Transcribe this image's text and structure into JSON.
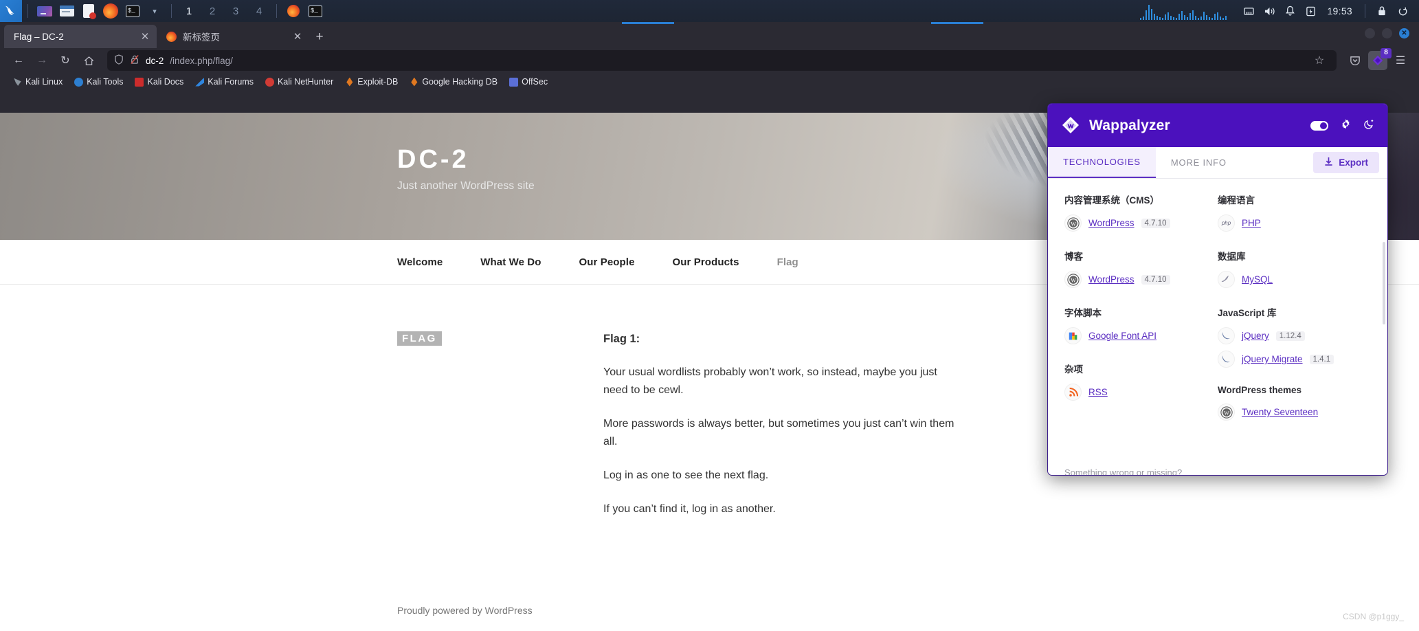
{
  "taskbar": {
    "menu_icon": "kali-dragon-icon",
    "launchers": [
      {
        "name": "app-grid-icon",
        "label": ""
      },
      {
        "name": "file-manager-icon",
        "label": ""
      },
      {
        "name": "text-editor-icon",
        "label": ""
      },
      {
        "name": "firefox-icon",
        "label": ""
      },
      {
        "name": "terminal-icon",
        "label": ""
      },
      {
        "name": "chevron-down-icon",
        "label": ""
      }
    ],
    "workspaces": [
      "1",
      "2",
      "3",
      "4"
    ],
    "active_workspace": "1",
    "running": [
      {
        "name": "firefox-window-icon"
      },
      {
        "name": "terminal-window-icon"
      }
    ],
    "tray": [
      {
        "name": "network-graph-icon"
      },
      {
        "name": "ethernet-icon"
      },
      {
        "name": "volume-icon"
      },
      {
        "name": "notification-bell-icon"
      },
      {
        "name": "battery-icon"
      }
    ],
    "clock": "19:53",
    "session": [
      {
        "name": "lock-icon"
      },
      {
        "name": "power-icon"
      }
    ]
  },
  "browser": {
    "tabs": [
      {
        "title": "Flag – DC-2",
        "active": true,
        "favicon": "none",
        "close": "✕"
      },
      {
        "title": "新标签页",
        "active": false,
        "favicon": "firefox-icon",
        "close": "✕"
      }
    ],
    "new_tab_label": "+",
    "window_controls": [
      "minimize",
      "maximize",
      "close"
    ],
    "nav": {
      "back": "←",
      "forward": "→",
      "reload": "↻",
      "home": "⌂"
    },
    "url": {
      "shield_icon": "shield-icon",
      "lock_icon": "lock-crossed-icon",
      "host": "dc-2",
      "path": "/index.php/flag/",
      "bookmark_star": "☆",
      "pocket_icon": "pocket-icon",
      "extension_icon": "wappalyzer-extension-icon",
      "extension_count": "8",
      "menu_icon": "☰"
    },
    "bookmarks": [
      {
        "label": "Kali Linux",
        "color": "#8a939c"
      },
      {
        "label": "Kali Tools",
        "color": "#2d7fd1"
      },
      {
        "label": "Kali Docs",
        "color": "#cc2c2c"
      },
      {
        "label": "Kali Forums",
        "color": "#2f86e0"
      },
      {
        "label": "Kali NetHunter",
        "color": "#d13b35"
      },
      {
        "label": "Exploit-DB",
        "color": "#e07820"
      },
      {
        "label": "Google Hacking DB",
        "color": "#e07820"
      },
      {
        "label": "OffSec",
        "color": "#5b6fd6"
      }
    ]
  },
  "page": {
    "site_title": "DC-2",
    "tagline": "Just another WordPress site",
    "nav_items": [
      {
        "label": "Welcome",
        "current": false
      },
      {
        "label": "What We Do",
        "current": false
      },
      {
        "label": "Our People",
        "current": false
      },
      {
        "label": "Our Products",
        "current": false
      },
      {
        "label": "Flag",
        "current": true
      }
    ],
    "page_badge": "FLAG",
    "article_heading": "Flag 1:",
    "paragraphs": [
      "Your usual wordlists probably won’t work, so instead, maybe you just need to be cewl.",
      "More passwords is always better, but sometimes you just can’t win them all.",
      "Log in as one to see the next flag.",
      "If you can’t find it, log in as another."
    ],
    "footer": "Proudly powered by WordPress",
    "watermark": "CSDN @p1ggy_"
  },
  "wappalyzer": {
    "title": "Wappalyzer",
    "logo_icon": "wappalyzer-diamond-icon",
    "header_icons": [
      {
        "name": "power-toggle"
      },
      {
        "name": "gear-icon"
      },
      {
        "name": "moon-icon"
      }
    ],
    "tabs": [
      {
        "label": "TECHNOLOGIES",
        "active": true
      },
      {
        "label": "MORE INFO",
        "active": false
      }
    ],
    "export_label": "Export",
    "export_icon": "download-icon",
    "footer_link": "Something wrong or missing?",
    "left_column": [
      {
        "category": "内容管理系统（CMS）",
        "items": [
          {
            "name": "WordPress",
            "version": "4.7.10",
            "icon": "wordpress-icon"
          }
        ]
      },
      {
        "category": "博客",
        "items": [
          {
            "name": "WordPress",
            "version": "4.7.10",
            "icon": "wordpress-icon"
          }
        ]
      },
      {
        "category": "字体脚本",
        "items": [
          {
            "name": "Google Font API",
            "version": "",
            "icon": "google-icon"
          }
        ]
      },
      {
        "category": "杂项",
        "items": [
          {
            "name": "RSS",
            "version": "",
            "icon": "rss-icon"
          }
        ]
      }
    ],
    "right_column": [
      {
        "category": "编程语言",
        "items": [
          {
            "name": "PHP",
            "version": "",
            "icon": "php-icon"
          }
        ]
      },
      {
        "category": "数据库",
        "items": [
          {
            "name": "MySQL",
            "version": "",
            "icon": "mysql-icon"
          }
        ]
      },
      {
        "category": "JavaScript 库",
        "items": [
          {
            "name": "jQuery",
            "version": "1.12.4",
            "icon": "jquery-icon"
          },
          {
            "name": "jQuery Migrate",
            "version": "1.4.1",
            "icon": "jquery-icon"
          }
        ]
      },
      {
        "category": "WordPress themes",
        "items": [
          {
            "name": "Twenty Seventeen",
            "version": "",
            "icon": "wordpress-icon"
          }
        ]
      }
    ]
  },
  "colors": {
    "wappalyzer_purple": "#4b11bd",
    "link_purple": "#5b2ec2",
    "taskbar_bg": "#20293a",
    "firefox_chrome": "#2b2a33",
    "accent_blue": "#2a7fd4"
  }
}
